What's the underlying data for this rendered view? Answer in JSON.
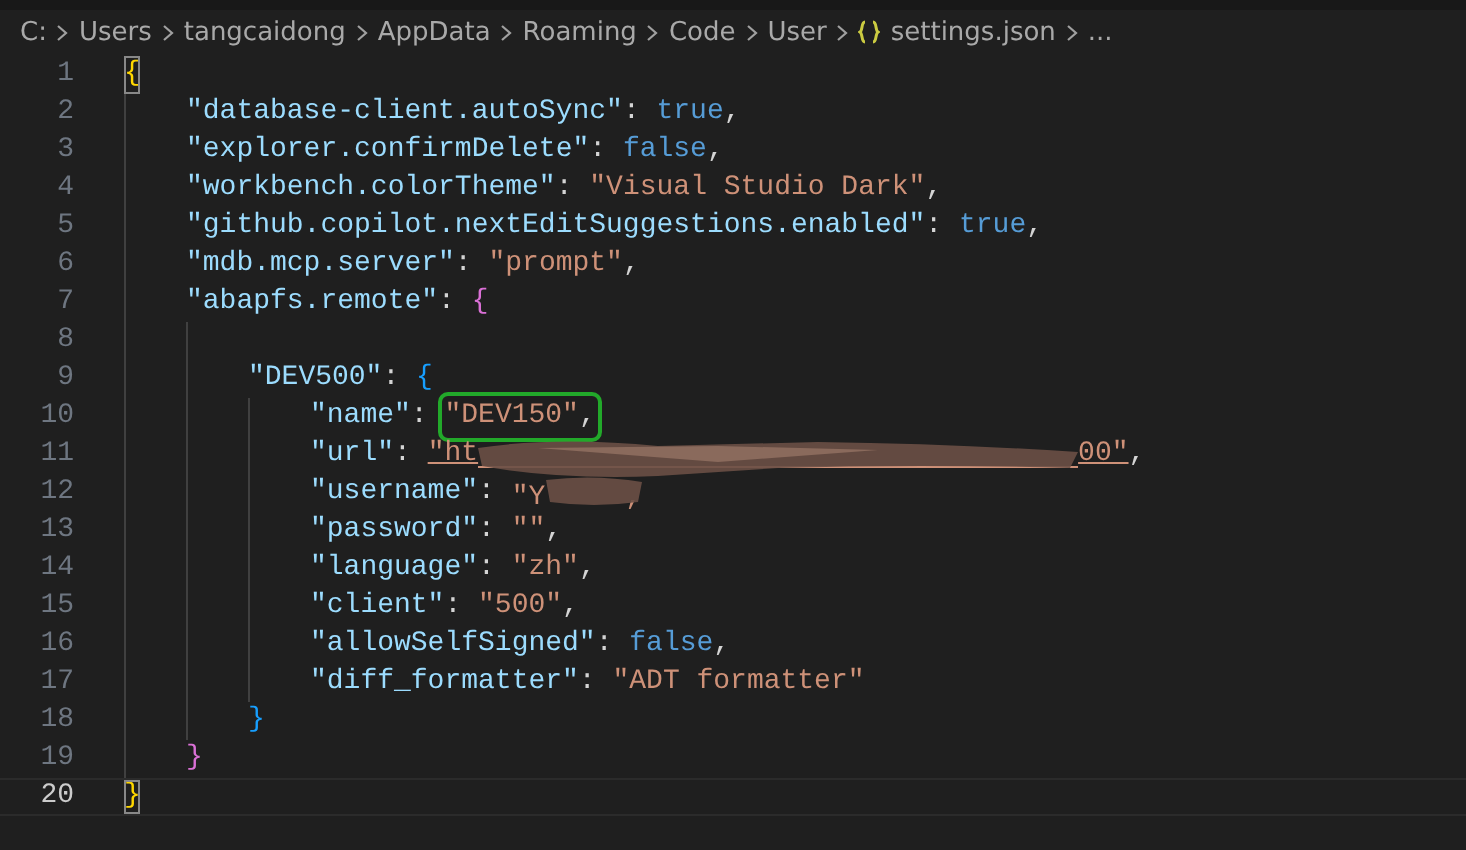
{
  "breadcrumb": {
    "items": [
      {
        "kind": "folder",
        "text": "C:"
      },
      {
        "kind": "folder",
        "text": "Users"
      },
      {
        "kind": "folder",
        "text": "tangcaidong"
      },
      {
        "kind": "folder",
        "text": "AppData"
      },
      {
        "kind": "folder",
        "text": "Roaming"
      },
      {
        "kind": "folder",
        "text": "Code"
      },
      {
        "kind": "folder",
        "text": "User"
      },
      {
        "kind": "json-file",
        "text": "settings.json"
      },
      {
        "kind": "more",
        "text": "..."
      }
    ]
  },
  "editor": {
    "lines": [
      {
        "number": "1",
        "current": false,
        "tokens": [
          {
            "kind": "bracket",
            "text": "{",
            "matched": true
          }
        ],
        "children": [
          {
            "number": "2",
            "current": false,
            "tokens": [
              {
                "kind": "key",
                "text": "\"database-client.autoSync\""
              },
              {
                "kind": "punct",
                "text": ": "
              },
              {
                "kind": "keyword",
                "text": "true"
              },
              {
                "kind": "punct",
                "text": ","
              }
            ]
          },
          {
            "number": "3",
            "current": false,
            "tokens": [
              {
                "kind": "key",
                "text": "\"explorer.confirmDelete\""
              },
              {
                "kind": "punct",
                "text": ": "
              },
              {
                "kind": "keyword",
                "text": "false"
              },
              {
                "kind": "punct",
                "text": ","
              }
            ]
          },
          {
            "number": "4",
            "current": false,
            "tokens": [
              {
                "kind": "key",
                "text": "\"workbench.colorTheme\""
              },
              {
                "kind": "punct",
                "text": ": "
              },
              {
                "kind": "string",
                "text": "\"Visual Studio Dark\""
              },
              {
                "kind": "punct",
                "text": ","
              }
            ]
          },
          {
            "number": "5",
            "current": false,
            "tokens": [
              {
                "kind": "key",
                "text": "\"github.copilot.nextEditSuggestions.enabled\""
              },
              {
                "kind": "punct",
                "text": ": "
              },
              {
                "kind": "keyword",
                "text": "true"
              },
              {
                "kind": "punct",
                "text": ","
              }
            ]
          },
          {
            "number": "6",
            "current": false,
            "tokens": [
              {
                "kind": "key",
                "text": "\"mdb.mcp.server\""
              },
              {
                "kind": "punct",
                "text": ": "
              },
              {
                "kind": "string",
                "text": "\"prompt\""
              },
              {
                "kind": "punct",
                "text": ","
              }
            ]
          },
          {
            "number": "7",
            "current": false,
            "tokens": [
              {
                "kind": "key",
                "text": "\"abapfs.remote\""
              },
              {
                "kind": "punct",
                "text": ": "
              },
              {
                "kind": "bracket",
                "text": "{",
                "matched": false
              }
            ],
            "children": [
              {
                "number": "8",
                "current": false
              },
              {
                "number": "9",
                "current": false,
                "tokens": [
                  {
                    "kind": "key",
                    "text": "\"DEV500\""
                  },
                  {
                    "kind": "punct",
                    "text": ": "
                  },
                  {
                    "kind": "bracket",
                    "text": "{",
                    "matched": false
                  }
                ],
                "children": [
                  {
                    "number": "10",
                    "current": false,
                    "tokens": [
                      {
                        "kind": "key",
                        "text": "\"name\""
                      },
                      {
                        "kind": "punct",
                        "text": ": "
                      },
                      {
                        "kind": "string",
                        "text": "\"DEV150\"",
                        "highlighted": true
                      },
                      {
                        "kind": "punct",
                        "text": ","
                      }
                    ]
                  },
                  {
                    "number": "11",
                    "current": false,
                    "tokens": [
                      {
                        "kind": "key",
                        "text": "\"url\""
                      },
                      {
                        "kind": "punct",
                        "text": ": "
                      },
                      {
                        "kind": "redacted-link",
                        "text": "\"ht",
                        "text_end": "00\""
                      },
                      {
                        "kind": "punct",
                        "text": ","
                      }
                    ]
                  },
                  {
                    "number": "12",
                    "current": false,
                    "tokens": [
                      {
                        "kind": "key",
                        "text": "\"username\""
                      },
                      {
                        "kind": "punct",
                        "text": ": "
                      },
                      {
                        "kind": "redacted-string",
                        "text": "\"Y",
                        "text_end": ","
                      }
                    ]
                  },
                  {
                    "number": "13",
                    "current": false,
                    "tokens": [
                      {
                        "kind": "key",
                        "text": "\"password\""
                      },
                      {
                        "kind": "punct",
                        "text": ": "
                      },
                      {
                        "kind": "string",
                        "text": "\"\""
                      },
                      {
                        "kind": "punct",
                        "text": ","
                      }
                    ]
                  },
                  {
                    "number": "14",
                    "current": false,
                    "tokens": [
                      {
                        "kind": "key",
                        "text": "\"language\""
                      },
                      {
                        "kind": "punct",
                        "text": ": "
                      },
                      {
                        "kind": "string",
                        "text": "\"zh\""
                      },
                      {
                        "kind": "punct",
                        "text": ","
                      }
                    ]
                  },
                  {
                    "number": "15",
                    "current": false,
                    "tokens": [
                      {
                        "kind": "key",
                        "text": "\"client\""
                      },
                      {
                        "kind": "punct",
                        "text": ": "
                      },
                      {
                        "kind": "string",
                        "text": "\"500\""
                      },
                      {
                        "kind": "punct",
                        "text": ","
                      }
                    ]
                  },
                  {
                    "number": "16",
                    "current": false,
                    "tokens": [
                      {
                        "kind": "key",
                        "text": "\"allowSelfSigned\""
                      },
                      {
                        "kind": "punct",
                        "text": ": "
                      },
                      {
                        "kind": "keyword",
                        "text": "false"
                      },
                      {
                        "kind": "punct",
                        "text": ","
                      }
                    ]
                  },
                  {
                    "number": "17",
                    "current": false,
                    "tokens": [
                      {
                        "kind": "key",
                        "text": "\"diff_formatter\""
                      },
                      {
                        "kind": "punct",
                        "text": ": "
                      },
                      {
                        "kind": "string",
                        "text": "\"ADT formatter\""
                      }
                    ]
                  }
                ]
              },
              {
                "number": "18",
                "current": false,
                "tokens": [
                  {
                    "kind": "bracket",
                    "text": "}",
                    "matched": false
                  }
                ]
              }
            ]
          },
          {
            "number": "19",
            "current": false,
            "tokens": [
              {
                "kind": "bracket",
                "text": "}",
                "matched": false
              }
            ]
          }
        ]
      },
      {
        "number": "20",
        "current": true,
        "tokens": [
          {
            "kind": "bracket",
            "text": "}",
            "matched": true
          }
        ]
      }
    ]
  }
}
